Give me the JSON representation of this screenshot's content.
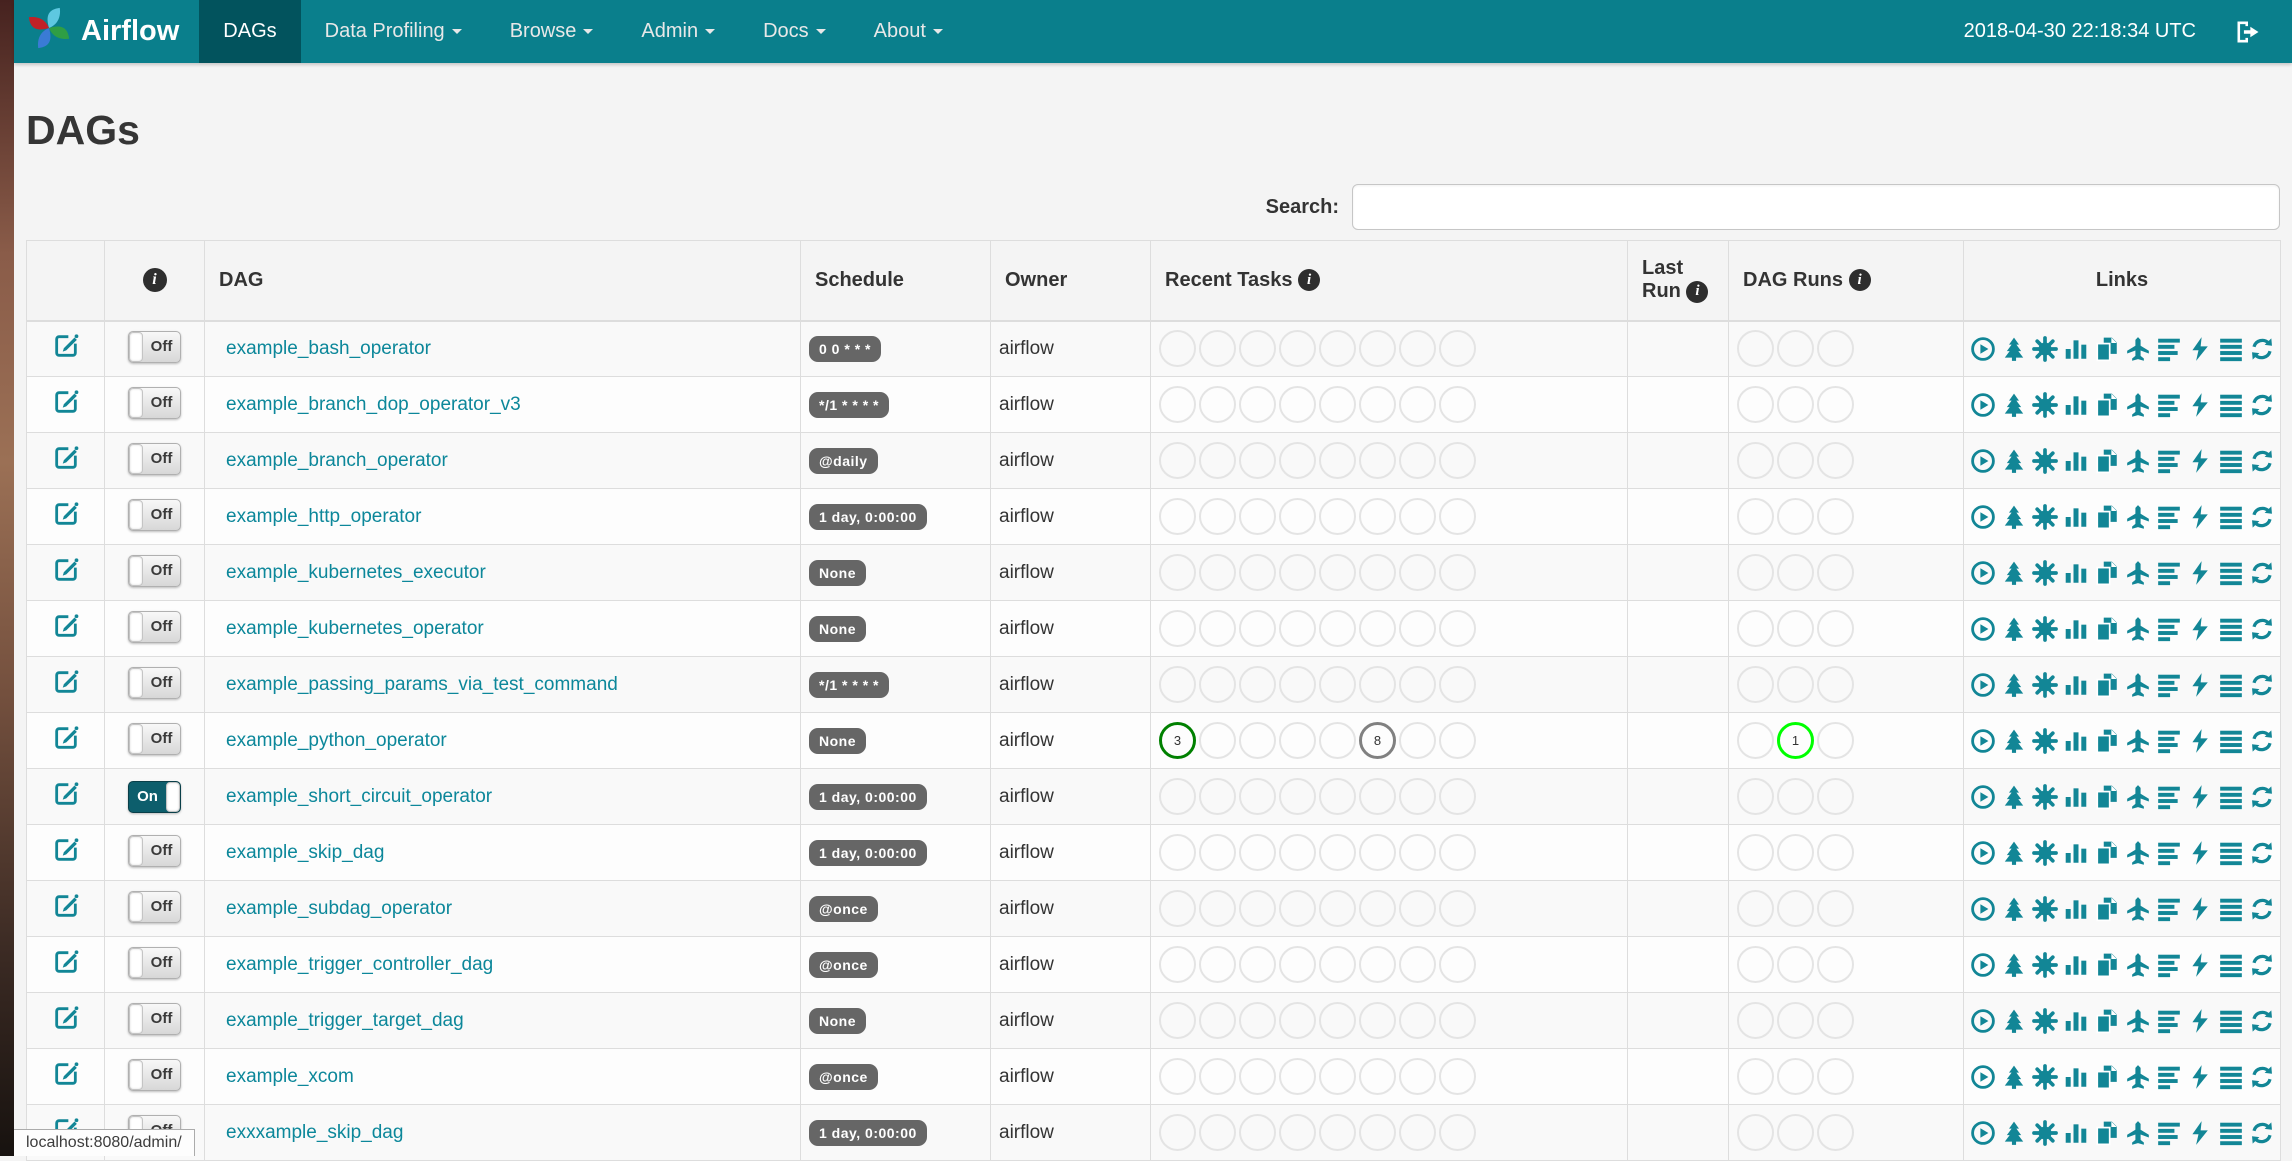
{
  "navbar": {
    "brand": "Airflow",
    "items": [
      {
        "label": "DAGs",
        "active": true,
        "has_dropdown": false
      },
      {
        "label": "Data Profiling",
        "active": false,
        "has_dropdown": true
      },
      {
        "label": "Browse",
        "active": false,
        "has_dropdown": true
      },
      {
        "label": "Admin",
        "active": false,
        "has_dropdown": true
      },
      {
        "label": "Docs",
        "active": false,
        "has_dropdown": true
      },
      {
        "label": "About",
        "active": false,
        "has_dropdown": true
      }
    ],
    "clock": "2018-04-30 22:18:34 UTC"
  },
  "page": {
    "title": "DAGs"
  },
  "search": {
    "label": "Search:",
    "value": "",
    "placeholder": ""
  },
  "table": {
    "headers": {
      "edit": "",
      "dag": "DAG",
      "schedule": "Schedule",
      "owner": "Owner",
      "recent_tasks": "Recent Tasks",
      "last_run": "Last Run",
      "dag_runs": "DAG Runs",
      "links": "Links"
    },
    "recent_task_slots": 8,
    "dag_run_slots": 3,
    "link_icons": [
      "trigger-dag",
      "tree-view",
      "graph-view",
      "task-duration",
      "task-tries",
      "landing-times",
      "gantt-view",
      "code-view",
      "log-view",
      "refresh"
    ],
    "rows": [
      {
        "dag": "example_bash_operator",
        "toggle": "Off",
        "schedule": "0 0 * * *",
        "owner": "airflow",
        "task_badges": [],
        "run_badges": []
      },
      {
        "dag": "example_branch_dop_operator_v3",
        "toggle": "Off",
        "schedule": "*/1 * * * *",
        "owner": "airflow",
        "task_badges": [],
        "run_badges": []
      },
      {
        "dag": "example_branch_operator",
        "toggle": "Off",
        "schedule": "@daily",
        "owner": "airflow",
        "task_badges": [],
        "run_badges": []
      },
      {
        "dag": "example_http_operator",
        "toggle": "Off",
        "schedule": "1 day, 0:00:00",
        "owner": "airflow",
        "task_badges": [],
        "run_badges": []
      },
      {
        "dag": "example_kubernetes_executor",
        "toggle": "Off",
        "schedule": "None",
        "owner": "airflow",
        "task_badges": [],
        "run_badges": []
      },
      {
        "dag": "example_kubernetes_operator",
        "toggle": "Off",
        "schedule": "None",
        "owner": "airflow",
        "task_badges": [],
        "run_badges": []
      },
      {
        "dag": "example_passing_params_via_test_command",
        "toggle": "Off",
        "schedule": "*/1 * * * *",
        "owner": "airflow",
        "task_badges": [],
        "run_badges": []
      },
      {
        "dag": "example_python_operator",
        "toggle": "Off",
        "schedule": "None",
        "owner": "airflow",
        "task_badges": [
          {
            "slot": 1,
            "count": "3",
            "state": "success"
          },
          {
            "slot": 6,
            "count": "8",
            "state": "queued"
          }
        ],
        "run_badges": [
          {
            "slot": 2,
            "count": "1",
            "state": "running"
          }
        ]
      },
      {
        "dag": "example_short_circuit_operator",
        "toggle": "On",
        "schedule": "1 day, 0:00:00",
        "owner": "airflow",
        "task_badges": [],
        "run_badges": []
      },
      {
        "dag": "example_skip_dag",
        "toggle": "Off",
        "schedule": "1 day, 0:00:00",
        "owner": "airflow",
        "task_badges": [],
        "run_badges": []
      },
      {
        "dag": "example_subdag_operator",
        "toggle": "Off",
        "schedule": "@once",
        "owner": "airflow",
        "task_badges": [],
        "run_badges": []
      },
      {
        "dag": "example_trigger_controller_dag",
        "toggle": "Off",
        "schedule": "@once",
        "owner": "airflow",
        "task_badges": [],
        "run_badges": []
      },
      {
        "dag": "example_trigger_target_dag",
        "toggle": "Off",
        "schedule": "None",
        "owner": "airflow",
        "task_badges": [],
        "run_badges": []
      },
      {
        "dag": "example_xcom",
        "toggle": "Off",
        "schedule": "@once",
        "owner": "airflow",
        "task_badges": [],
        "run_badges": []
      },
      {
        "dag": "exxxample_skip_dag",
        "toggle": "Off",
        "schedule": "1 day, 0:00:00",
        "owner": "airflow",
        "task_badges": [],
        "run_badges": []
      }
    ]
  },
  "status_bar": {
    "text": "localhost:8080/admin/"
  },
  "colors": {
    "navbar": "#0a7f8c",
    "navbar_active": "#02535d",
    "link": "#0c879a",
    "icon": "#128696",
    "schedule_badge_bg": "#666666",
    "success": "#008000",
    "running": "#00ff00",
    "queued": "#808080",
    "toggle_on": "#0d5e6c"
  }
}
